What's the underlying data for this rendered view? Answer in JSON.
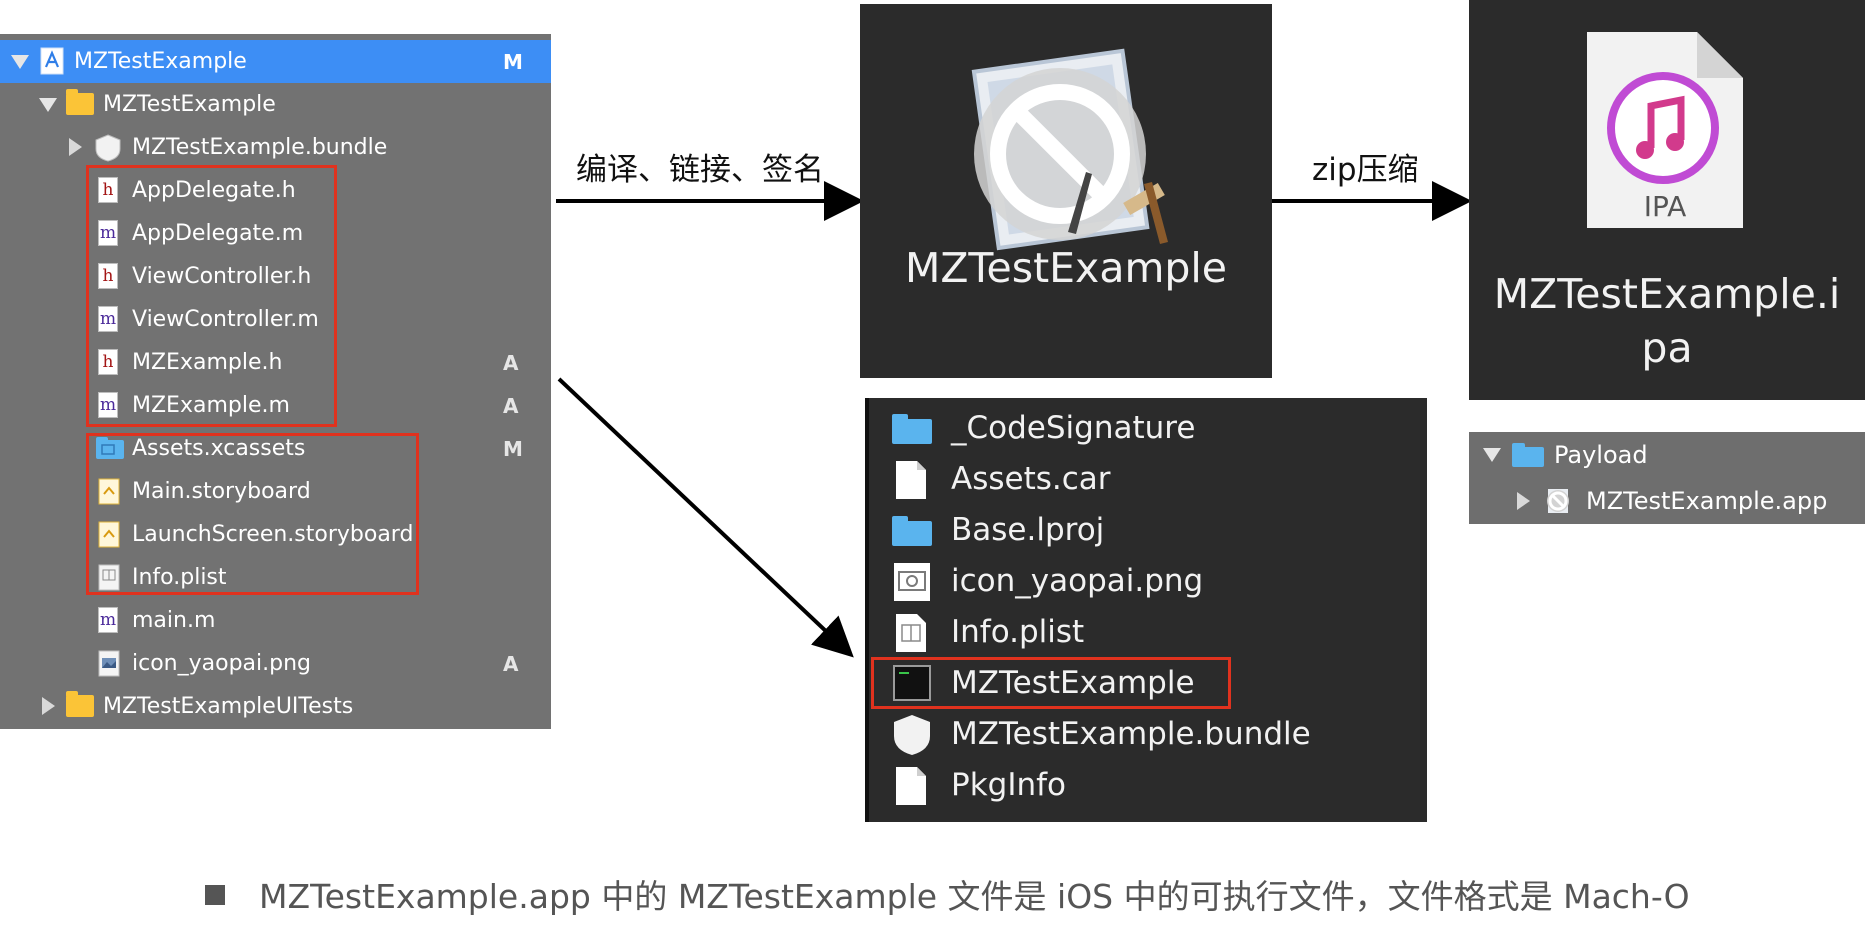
{
  "navigator": {
    "rows": [
      {
        "label": "MZTestExample",
        "badge": "M"
      },
      {
        "label": "MZTestExample",
        "badge": ""
      },
      {
        "label": "MZTestExample.bundle",
        "badge": ""
      },
      {
        "label": "AppDelegate.h",
        "badge": ""
      },
      {
        "label": "AppDelegate.m",
        "badge": ""
      },
      {
        "label": "ViewController.h",
        "badge": ""
      },
      {
        "label": "ViewController.m",
        "badge": ""
      },
      {
        "label": "MZExample.h",
        "badge": "A"
      },
      {
        "label": "MZExample.m",
        "badge": "A"
      },
      {
        "label": "Assets.xcassets",
        "badge": "M"
      },
      {
        "label": "Main.storyboard",
        "badge": ""
      },
      {
        "label": "LaunchScreen.storyboard",
        "badge": ""
      },
      {
        "label": "Info.plist",
        "badge": ""
      },
      {
        "label": "main.m",
        "badge": ""
      },
      {
        "label": "icon_yaopai.png",
        "badge": "A"
      },
      {
        "label": "MZTestExampleUITests",
        "badge": ""
      }
    ],
    "file_glyphs": {
      "header": "h",
      "impl": "m"
    }
  },
  "arrows": {
    "compile_label": "编译、链接、签名",
    "zip_label": "zip压缩"
  },
  "app": {
    "name": "MZTestExample"
  },
  "ipa": {
    "badge": "IPA",
    "name_line1": "MZTestExample.i",
    "name_line2": "pa"
  },
  "bundle_contents": [
    {
      "label": "_CodeSignature"
    },
    {
      "label": "Assets.car"
    },
    {
      "label": "Base.lproj"
    },
    {
      "label": "icon_yaopai.png"
    },
    {
      "label": "Info.plist"
    },
    {
      "label": "MZTestExample"
    },
    {
      "label": "MZTestExample.bundle"
    },
    {
      "label": "PkgInfo"
    }
  ],
  "payload": {
    "folder": "Payload",
    "app": "MZTestExample.app"
  },
  "caption": "MZTestExample.app  中的  MZTestExample  文件是  iOS  中的可执行文件，文件格式是  Mach-O",
  "colors": {
    "highlight_red": "#e0321e",
    "selection_blue": "#3d8ef5",
    "navigator_bg": "#727272",
    "panel_dark": "#2b2b2b"
  }
}
